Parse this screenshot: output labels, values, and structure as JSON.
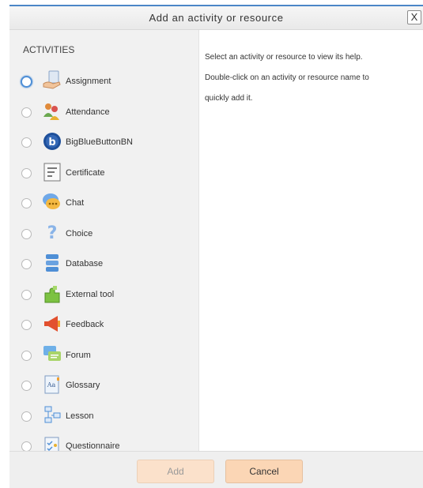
{
  "dialog": {
    "title": "Add an activity or resource",
    "close_label": "X"
  },
  "activities": {
    "heading": "ACTIVITIES",
    "selected_index": 0,
    "items": [
      {
        "label": "Assignment",
        "icon": "assignment-icon"
      },
      {
        "label": "Attendance",
        "icon": "attendance-icon"
      },
      {
        "label": "BigBlueButtonBN",
        "icon": "bigbluebutton-icon"
      },
      {
        "label": "Certificate",
        "icon": "certificate-icon"
      },
      {
        "label": "Chat",
        "icon": "chat-icon"
      },
      {
        "label": "Choice",
        "icon": "choice-icon"
      },
      {
        "label": "Database",
        "icon": "database-icon"
      },
      {
        "label": "External tool",
        "icon": "external-tool-icon"
      },
      {
        "label": "Feedback",
        "icon": "feedback-icon"
      },
      {
        "label": "Forum",
        "icon": "forum-icon"
      },
      {
        "label": "Glossary",
        "icon": "glossary-icon"
      },
      {
        "label": "Lesson",
        "icon": "lesson-icon"
      },
      {
        "label": "Questionnaire",
        "icon": "questionnaire-icon"
      }
    ]
  },
  "help": {
    "line1": "Select an activity or resource to view its help.",
    "line2": "Double-click on an activity or resource name to",
    "line3": "quickly add it."
  },
  "footer": {
    "add_label": "Add",
    "cancel_label": "Cancel"
  },
  "colors": {
    "accent": "#4f8fd6",
    "button": "#fbd6b5"
  }
}
